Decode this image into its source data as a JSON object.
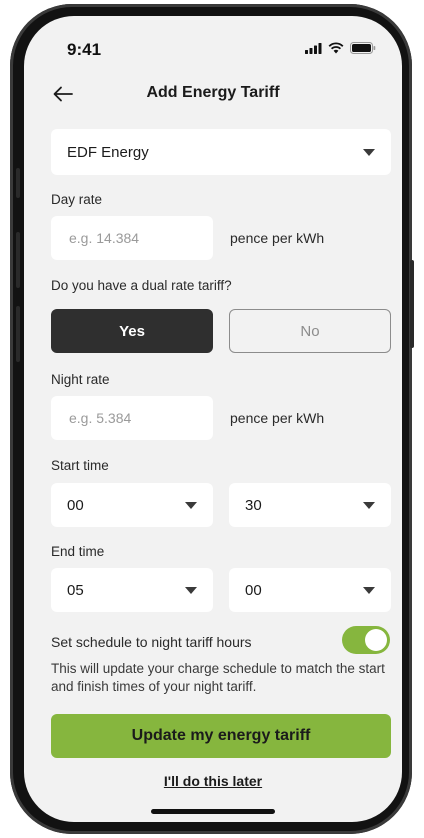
{
  "status_bar": {
    "time": "9:41",
    "icons": [
      "cellular-signal-icon",
      "wifi-icon",
      "battery-icon"
    ]
  },
  "header": {
    "title": "Add Energy Tariff",
    "back_icon": "arrow-left-icon"
  },
  "supplier": {
    "selected": "EDF Energy"
  },
  "day_rate": {
    "label": "Day rate",
    "placeholder": "e.g. 14.384",
    "unit": "pence per kWh"
  },
  "dual_rate": {
    "question": "Do you have a dual rate tariff?",
    "yes_label": "Yes",
    "no_label": "No",
    "selected": "Yes"
  },
  "night_rate": {
    "label": "Night rate",
    "placeholder": "e.g. 5.384",
    "unit": "pence per kWh"
  },
  "start_time": {
    "label": "Start time",
    "hour": "00",
    "minute": "30"
  },
  "end_time": {
    "label": "End time",
    "hour": "05",
    "minute": "00"
  },
  "schedule": {
    "label": "Set schedule to night tariff hours",
    "enabled": true,
    "description": "This will update your charge schedule to match the start and finish times of your night tariff."
  },
  "actions": {
    "primary_label": "Update my energy tariff",
    "later_label": "I'll do this later"
  },
  "colors": {
    "accent": "#86b63e",
    "selected_segment": "#2f2f2f",
    "screen_background": "#f2f2f2"
  }
}
